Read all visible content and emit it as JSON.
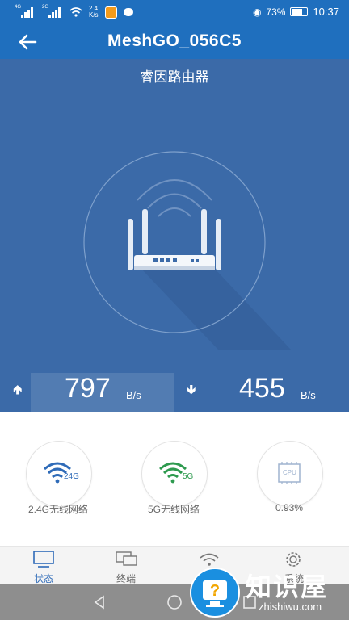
{
  "status_bar": {
    "net1": "4G",
    "net2": "2G",
    "speed": "2.4",
    "speed_unit": "K/s",
    "battery": "73%",
    "time": "10:37"
  },
  "header": {
    "title": "MeshGO_056C5"
  },
  "device": {
    "name": "睿因路由器"
  },
  "speed": {
    "up_value": "797",
    "up_unit": "B/s",
    "down_value": "455",
    "down_unit": "B/s"
  },
  "stats": [
    {
      "label": "2.4G无线网络",
      "icon_text": "24G",
      "color": "#2f6bb8"
    },
    {
      "label": "5G无线网络",
      "icon_text": "5G",
      "color": "#2e9a4f"
    },
    {
      "label": "0.93%",
      "icon_text": "CPU",
      "color": "#9fb3cf"
    }
  ],
  "tabs": [
    {
      "label": "状态",
      "active": true
    },
    {
      "label": "终端",
      "active": false
    },
    {
      "label": "",
      "active": false
    },
    {
      "label": "系统",
      "active": false
    }
  ],
  "watermark": {
    "text": "知识屋",
    "sub": "zhishiwu.com"
  }
}
